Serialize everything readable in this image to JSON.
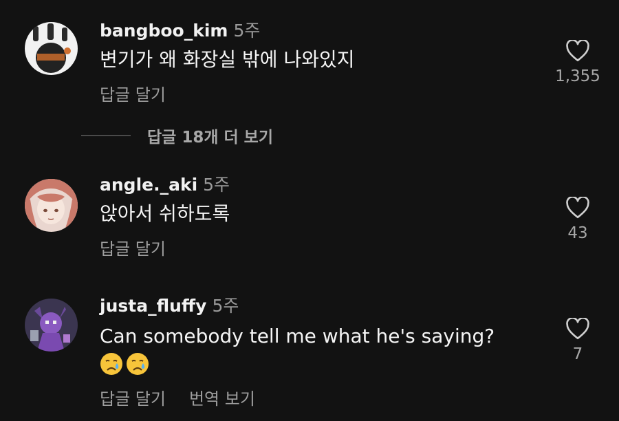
{
  "comments": [
    {
      "username": "bangboo_kim",
      "time": "5주",
      "text": "변기가 왜 화장실 밖에 나와있지",
      "reply_label": "답글 달기",
      "likes": "1,355",
      "avatar_icon": "avatar-photo-icon"
    },
    {
      "username": "angle._aki",
      "time": "5주",
      "text": "앉아서 쉬하도록",
      "reply_label": "답글 달기",
      "likes": "43",
      "avatar_icon": "avatar-anime-girl-icon"
    },
    {
      "username": "justa_fluffy",
      "time": "5주",
      "text": "Can somebody tell me what he's saying?",
      "emojis": [
        "crying-face-emoji",
        "crying-face-emoji"
      ],
      "reply_label": "답글 달기",
      "translate_label": "번역 보기",
      "likes": "7",
      "avatar_icon": "avatar-purple-character-icon"
    }
  ],
  "more_replies": {
    "label": "답글 18개 더 보기"
  },
  "colors": {
    "background": "#121212",
    "text_primary": "#f5f5f5",
    "text_secondary": "#9e9e9e"
  }
}
